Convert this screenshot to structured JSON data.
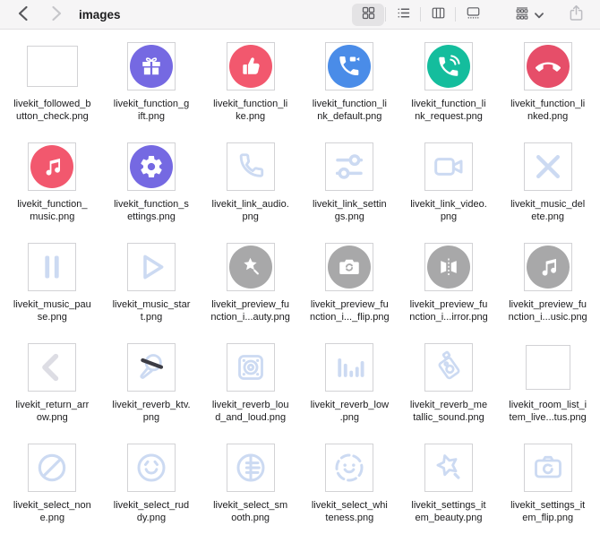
{
  "window": {
    "title": "images"
  },
  "toolbar": {
    "back": "back",
    "forward": "forward",
    "views": [
      "grid",
      "list",
      "columns",
      "gallery"
    ],
    "selected_view": "grid",
    "group_button": "group-by",
    "share_button": "share"
  },
  "palette": {
    "purple": "#7569e2",
    "pink": "#f2586e",
    "blue": "#4a8ce8",
    "teal": "#14bd9d",
    "crimson": "#e64e69",
    "gray": "#a8a8a9",
    "pale_blue": "#ccdaf2",
    "pale_gray": "#dddde4",
    "dark_slash": "#3c3c44",
    "toolbar_icon": "#5e5e63",
    "toolbar_icon_disabled": "#c3c3c7",
    "toolbar_bg": "#f6f5f6",
    "selected_view_bg": "#e4e3e5"
  },
  "files": [
    {
      "line1": "livekit_followed_b",
      "line2": "utton_check.png",
      "icon": "blank-wide"
    },
    {
      "line1": "livekit_function_g",
      "line2": "ift.png",
      "icon": "gift",
      "bg": "purple"
    },
    {
      "line1": "livekit_function_li",
      "line2": "ke.png",
      "icon": "thumbs-up",
      "bg": "pink"
    },
    {
      "line1": "livekit_function_li",
      "line2": "nk_default.png",
      "icon": "video-call",
      "bg": "blue"
    },
    {
      "line1": "livekit_function_li",
      "line2": "nk_request.png",
      "icon": "phone-ring",
      "bg": "teal"
    },
    {
      "line1": "livekit_function_li",
      "line2": "nked.png",
      "icon": "phone-down",
      "bg": "crimson"
    },
    {
      "line1": "livekit_function_",
      "line2": "music.png",
      "icon": "music",
      "bg": "pink"
    },
    {
      "line1": "livekit_function_s",
      "line2": "ettings.png",
      "icon": "gear",
      "bg": "purple"
    },
    {
      "line1": "livekit_link_audio.",
      "line2": "png",
      "icon": "phone-outline"
    },
    {
      "line1": "livekit_link_settin",
      "line2": "gs.png",
      "icon": "sliders"
    },
    {
      "line1": "livekit_link_video.",
      "line2": "png",
      "icon": "video-outline"
    },
    {
      "line1": "livekit_music_del",
      "line2": "ete.png",
      "icon": "x-mark"
    },
    {
      "line1": "livekit_music_pau",
      "line2": "se.png",
      "icon": "pause"
    },
    {
      "line1": "livekit_music_star",
      "line2": "t.png",
      "icon": "play"
    },
    {
      "line1": "livekit_preview_fu",
      "line2": "nction_i...auty.png",
      "icon": "wand",
      "bg": "gray"
    },
    {
      "line1": "livekit_preview_fu",
      "line2": "nction_i..._flip.png",
      "icon": "camera-flip",
      "bg": "gray"
    },
    {
      "line1": "livekit_preview_fu",
      "line2": "nction_i...irror.png",
      "icon": "mirror",
      "bg": "gray"
    },
    {
      "line1": "livekit_preview_fu",
      "line2": "nction_i...usic.png",
      "icon": "music",
      "bg": "gray"
    },
    {
      "line1": "livekit_return_arr",
      "line2": "ow.png",
      "icon": "chevron-left"
    },
    {
      "line1": "livekit_reverb_ktv.",
      "line2": "png",
      "icon": "mic-slash"
    },
    {
      "line1": "livekit_reverb_lou",
      "line2": "d_and_loud.png",
      "icon": "speaker-box"
    },
    {
      "line1": "livekit_reverb_low",
      "line2": ".png",
      "icon": "eq-bars"
    },
    {
      "line1": "livekit_reverb_me",
      "line2": "tallic_sound.png",
      "icon": "metallic-speaker"
    },
    {
      "line1": "livekit_room_list_i",
      "line2": "tem_live...tus.png",
      "icon": "blank-square"
    },
    {
      "line1": "livekit_select_non",
      "line2": "e.png",
      "icon": "none-circle"
    },
    {
      "line1": "livekit_select_rud",
      "line2": "dy.png",
      "icon": "smiley"
    },
    {
      "line1": "livekit_select_sm",
      "line2": "ooth.png",
      "icon": "contrast-circle"
    },
    {
      "line1": "livekit_select_whi",
      "line2": "teness.png",
      "icon": "dotted-smiley"
    },
    {
      "line1": "livekit_settings_it",
      "line2": "em_beauty.png",
      "icon": "star-outline"
    },
    {
      "line1": "livekit_settings_it",
      "line2": "em_flip.png",
      "icon": "camera-outline"
    }
  ]
}
